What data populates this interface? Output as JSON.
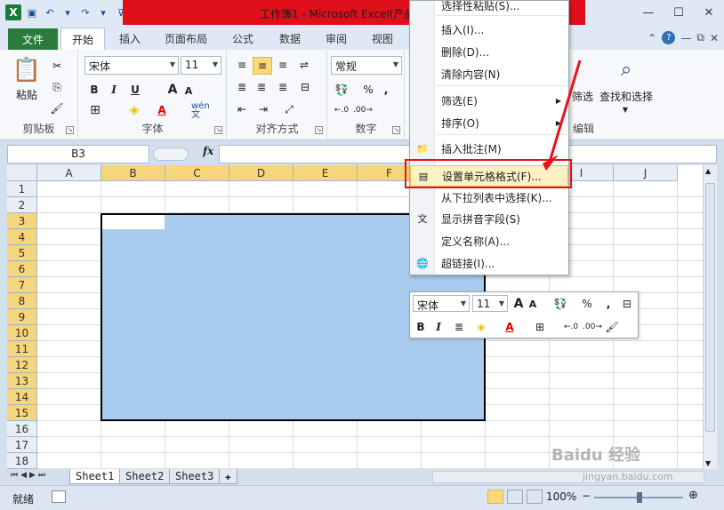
{
  "window": {
    "title": "工作簿1 - Microsoft Excel(产品",
    "app_logo": "X",
    "controls": [
      "minimize-icon",
      "maximize-icon",
      "close-icon"
    ]
  },
  "tabs": {
    "file": "文件",
    "items": [
      "开始",
      "插入",
      "页面布局",
      "公式",
      "数据",
      "审阅",
      "视图"
    ]
  },
  "ribbon": {
    "clipboard": {
      "paste": "粘贴",
      "label": "剪贴板"
    },
    "font": {
      "name": "宋体",
      "size": "11",
      "bold": "B",
      "italic": "I",
      "underline": "U",
      "grow": "A",
      "shrink": "A",
      "color_a": "A",
      "label": "字体",
      "phonetic": "wén 文"
    },
    "alignment": {
      "label": "对齐方式"
    },
    "number": {
      "format": "常规",
      "percent": "%",
      "comma": ",",
      "label": "数字"
    },
    "editing": {
      "filter": "筛选",
      "find": "查找和选择",
      "label": "编辑"
    }
  },
  "formula_bar": {
    "namebox": "B3",
    "fx": "fx",
    "value": ""
  },
  "grid": {
    "columns": [
      "A",
      "B",
      "C",
      "D",
      "E",
      "F",
      "G",
      "H",
      "I",
      "J"
    ],
    "selected_columns": [
      "B",
      "C",
      "D",
      "E",
      "F",
      "G"
    ],
    "rows": [
      "1",
      "2",
      "3",
      "4",
      "5",
      "6",
      "7",
      "8",
      "9",
      "10",
      "11",
      "12",
      "13",
      "14",
      "15",
      "16",
      "17",
      "18"
    ],
    "selected_rows": [
      "3",
      "4",
      "5",
      "6",
      "7",
      "8",
      "9",
      "10",
      "11",
      "12",
      "13",
      "14",
      "15"
    ],
    "active_cell": "B3"
  },
  "context_menu": {
    "items": [
      {
        "label": "选择性粘贴(S)...",
        "icon": ""
      },
      {
        "label": "插入(I)...",
        "icon": ""
      },
      {
        "label": "删除(D)...",
        "icon": ""
      },
      {
        "label": "清除内容(N)",
        "icon": ""
      },
      {
        "label": "筛选(E)",
        "icon": "",
        "submenu": true
      },
      {
        "label": "排序(O)",
        "icon": "",
        "submenu": true
      },
      {
        "label": "插入批注(M)",
        "icon": "comment-icon"
      },
      {
        "label": "设置单元格格式(F)...",
        "icon": "format-cells-icon",
        "highlighted": true
      },
      {
        "label": "从下拉列表中选择(K)...",
        "icon": ""
      },
      {
        "label": "显示拼音字段(S)",
        "icon": "phonetic-icon"
      },
      {
        "label": "定义名称(A)...",
        "icon": ""
      },
      {
        "label": "超链接(I)...",
        "icon": "hyperlink-icon"
      }
    ]
  },
  "mini_toolbar": {
    "font": "宋体",
    "size": "11",
    "bold": "B",
    "italic": "I",
    "percent": "%",
    "comma": ","
  },
  "sheets": [
    "Sheet1",
    "Sheet2",
    "Sheet3"
  ],
  "status": {
    "ready": "就绪",
    "zoom": "100%"
  },
  "watermark": {
    "text": "Baidu 经验",
    "sub": "jingyan.baidu.com"
  },
  "colors": {
    "title_red": "#e0101a",
    "file_tab": "#2b7a3e",
    "selection": "#a8cbee",
    "selected_header": "#f7d57a",
    "highlight_box": "#e8101a"
  }
}
